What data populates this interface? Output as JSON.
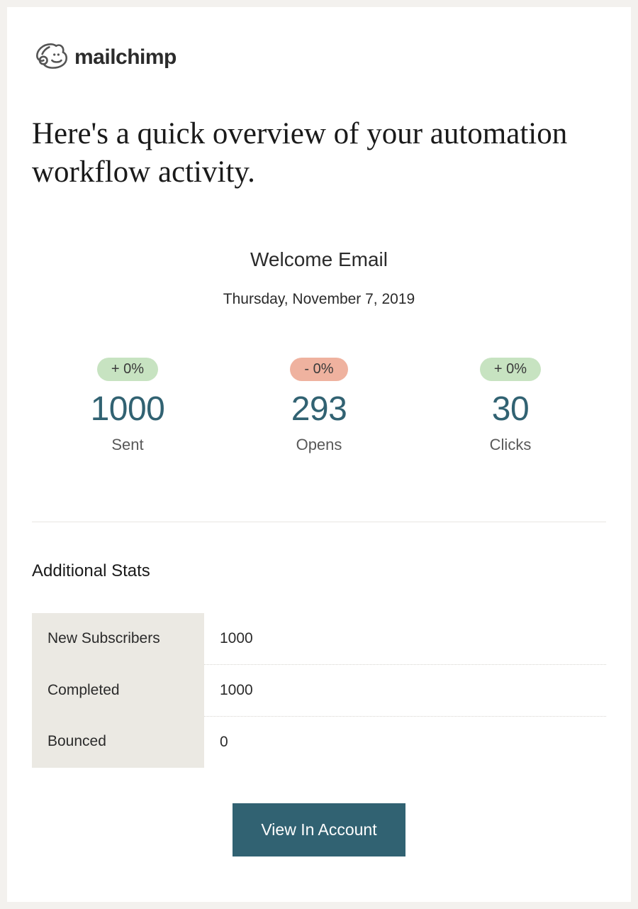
{
  "brand": {
    "name": "mailchimp"
  },
  "headline": "Here's a quick overview of your automation workflow activity.",
  "campaign": {
    "title": "Welcome Email",
    "date": "Thursday, November 7, 2019"
  },
  "metrics": [
    {
      "delta": "+ 0%",
      "delta_kind": "positive",
      "value": "1000",
      "label": "Sent"
    },
    {
      "delta": "- 0%",
      "delta_kind": "negative",
      "value": "293",
      "label": "Opens"
    },
    {
      "delta": "+ 0%",
      "delta_kind": "positive",
      "value": "30",
      "label": "Clicks"
    }
  ],
  "additional": {
    "heading": "Additional Stats",
    "rows": [
      {
        "key": "New Subscribers",
        "value": "1000"
      },
      {
        "key": "Completed",
        "value": "1000"
      },
      {
        "key": "Bounced",
        "value": "0"
      }
    ]
  },
  "cta": {
    "label": "View In Account"
  },
  "colors": {
    "accent": "#316272",
    "badge_positive": "#c7e3c1",
    "badge_negative": "#efb29f"
  }
}
